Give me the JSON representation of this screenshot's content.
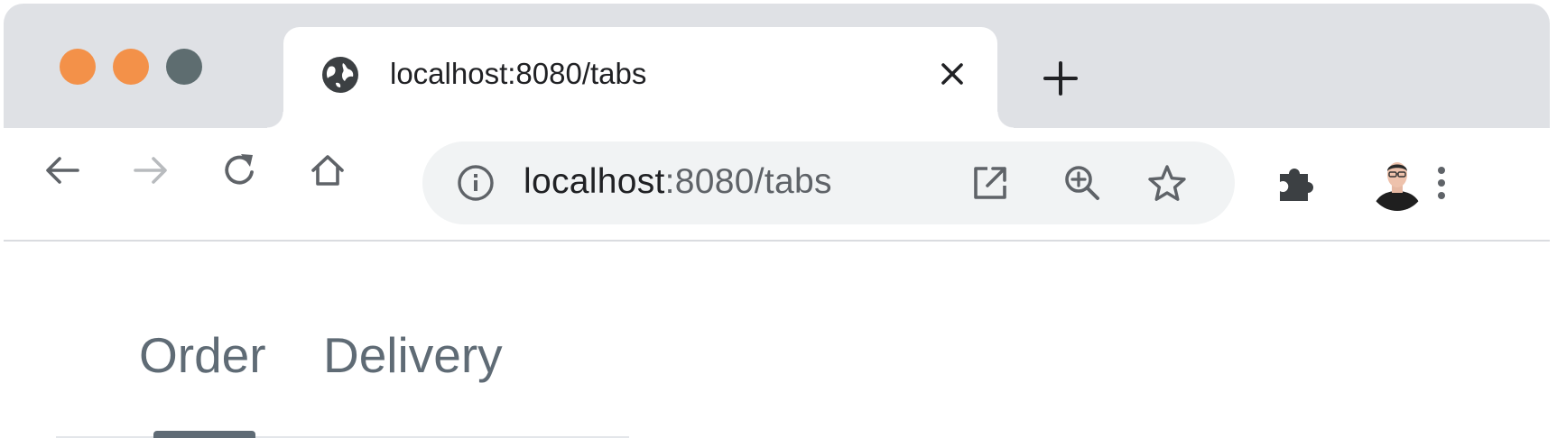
{
  "window": {
    "traffic_lights": [
      {
        "name": "close",
        "color": "#f39149"
      },
      {
        "name": "minimize",
        "color": "#f39149"
      },
      {
        "name": "maximize",
        "color": "#5e6d70"
      }
    ]
  },
  "browser_tab": {
    "title": "localhost:8080/tabs",
    "favicon": "globe-icon",
    "close_icon": "close-icon"
  },
  "new_tab": {
    "icon": "plus-icon"
  },
  "toolbar": {
    "back_icon": "arrow-left-icon",
    "forward_icon": "arrow-right-icon",
    "reload_icon": "reload-icon",
    "home_icon": "home-icon",
    "extensions_icon": "puzzle-icon",
    "menu_icon": "more-vertical-icon"
  },
  "omnibox": {
    "info_icon": "info-icon",
    "url_host": "localhost",
    "url_rest": ":8080/tabs",
    "open_icon": "open-in-new-icon",
    "zoom_icon": "zoom-in-icon",
    "bookmark_icon": "star-icon"
  },
  "page": {
    "tabs": [
      {
        "label": "Order",
        "active": true
      },
      {
        "label": "Delivery",
        "active": false
      }
    ],
    "accent_color": "#5f6b75"
  }
}
